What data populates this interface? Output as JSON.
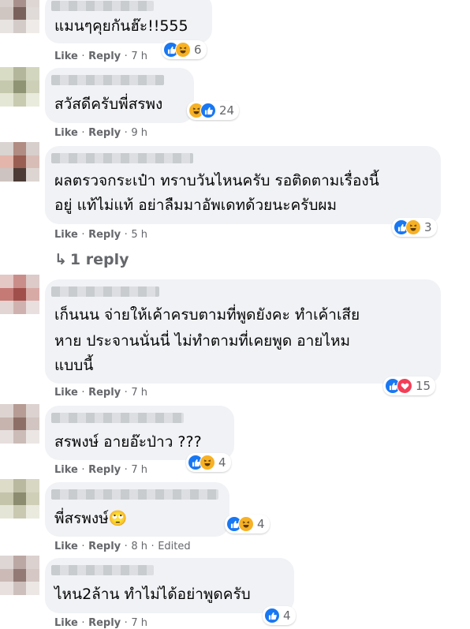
{
  "comments": [
    {
      "text": [
        "แมนๆคุยกันฮ๊ะ!!555"
      ],
      "reactions": [
        "like",
        "haha"
      ],
      "count": "6",
      "actions": {
        "like": "Like",
        "reply": "Reply",
        "time": "7 h"
      }
    },
    {
      "text": [
        "สวัสดีครับพี่สรพง"
      ],
      "reactions": [
        "haha",
        "like"
      ],
      "count": "24",
      "actions": {
        "like": "Like",
        "reply": "Reply",
        "time": "9 h"
      }
    },
    {
      "text": [
        "ผลตรวจกระเป๋า ทราบวันไหนครับ รอติดตามเรื่องนี้",
        "อยู่ แท้ไม่แท้ อย่าลืมมาอัพเดทด้วยนะครับผม"
      ],
      "reactions": [
        "like",
        "haha"
      ],
      "count": "3",
      "actions": {
        "like": "Like",
        "reply": "Reply",
        "time": "5 h"
      },
      "replies_link": "1 reply"
    },
    {
      "text": [
        "เก็นนน จ่ายให้เค้าครบตามที่พูดยังคะ ทำเค้าเสีย",
        "หาย ประจานนั่นนี่ ไม่ทำตามที่เคยพูด อายไหม",
        "แบบนี้"
      ],
      "reactions": [
        "like",
        "love"
      ],
      "count": "15",
      "actions": {
        "like": "Like",
        "reply": "Reply",
        "time": "7 h"
      }
    },
    {
      "text": [
        "สรพงษ์ อายอ๊ะป่าว ???"
      ],
      "reactions": [
        "like",
        "haha"
      ],
      "count": "4",
      "actions": {
        "like": "Like",
        "reply": "Reply",
        "time": "7 h"
      }
    },
    {
      "text": [
        "พี่สรพงษ์🙄"
      ],
      "reactions": [
        "like",
        "haha"
      ],
      "count": "4",
      "actions": {
        "like": "Like",
        "reply": "Reply",
        "time": "8 h",
        "edited": "Edited"
      }
    },
    {
      "text": [
        "ไหน2ล้าน ทำไม่ได้อย่าพูดครับ"
      ],
      "reactions": [
        "like"
      ],
      "count": "4",
      "actions": {
        "like": "Like",
        "reply": "Reply",
        "time": "7 h"
      }
    }
  ],
  "separator": "·",
  "reply_arrow": "↳",
  "colors": {
    "bubble": "#f0f2f5",
    "meta": "#65676b",
    "like": "#1877f2",
    "haha": "#f7b125",
    "love": "#f33e58"
  }
}
